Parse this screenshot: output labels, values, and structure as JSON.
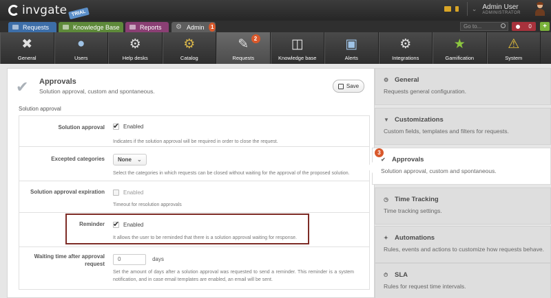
{
  "brand": {
    "name": "invgate",
    "edition": "TRIAL"
  },
  "user": {
    "name": "Admin User",
    "role": "ADMINISTRATOR"
  },
  "tabs": [
    {
      "label": "Requests",
      "color": "#3d6ea8"
    },
    {
      "label": "Knowledge Base",
      "color": "#5e8a3a"
    },
    {
      "label": "Reports",
      "color": "#8b3f74"
    },
    {
      "label": "Admin",
      "color": "#5e5e5e",
      "badge": "1"
    }
  ],
  "search": {
    "placeholder": "Go to..."
  },
  "alerts": {
    "count": "0"
  },
  "toolbar": [
    {
      "label": "General",
      "icon": "tools-icon"
    },
    {
      "label": "Users",
      "icon": "users-icon"
    },
    {
      "label": "Help desks",
      "icon": "helpdesk-icon"
    },
    {
      "label": "Catalog",
      "icon": "catalog-icon"
    },
    {
      "label": "Requests",
      "icon": "requests-icon",
      "active": true,
      "badge": "2"
    },
    {
      "label": "Knowledge base",
      "icon": "database-icon"
    },
    {
      "label": "Alerts",
      "icon": "alerts-icon"
    },
    {
      "label": "Integrations",
      "icon": "integrations-icon"
    },
    {
      "label": "Gamification",
      "icon": "gamification-icon"
    },
    {
      "label": "System",
      "icon": "system-icon"
    }
  ],
  "page": {
    "title": "Approvals",
    "subtitle": "Solution approval, custom and spontaneous.",
    "save_label": "Save",
    "section_title": "Solution approval"
  },
  "fields": {
    "solution_approval": {
      "label": "Solution approval",
      "value": "Enabled",
      "hint": "Indicates if the solution approval will be required in order to close the request."
    },
    "excepted_categories": {
      "label": "Excepted categories",
      "value": "None",
      "hint": "Select the categories in which requests can be closed without waiting for the approval of the proposed solution."
    },
    "expiration": {
      "label": "Solution approval expiration",
      "value": "Enabled",
      "hint": "Timeout for resolution approvals"
    },
    "reminder": {
      "label": "Reminder",
      "value": "Enabled",
      "hint": "It allows the user to be reminded that there is a solution approval waiting for response."
    },
    "waiting_time": {
      "label": "Waiting time after approval request",
      "value": "0",
      "unit": "days",
      "hint": "Set the amount of days after a solution approval was requested to send a reminder. This reminder is a system notification, and in case email templates are enabled, an email will be sent."
    }
  },
  "sidebar": [
    {
      "title": "General",
      "desc": "Requests general configuration.",
      "icon": "gear-icon"
    },
    {
      "title": "Customizations",
      "desc": "Custom fields, templates and filters for requests.",
      "icon": "filter-icon"
    },
    {
      "title": "Approvals",
      "desc": "Solution approval, custom and spontaneous.",
      "icon": "check-icon",
      "active": true,
      "badge": "3"
    },
    {
      "title": "Time Tracking",
      "desc": "Time tracking settings.",
      "icon": "clock-icon"
    },
    {
      "title": "Automations",
      "desc": "Rules, events and actions to customize how requests behave.",
      "icon": "wand-icon"
    },
    {
      "title": "SLA",
      "desc": "Rules for request time intervals.",
      "icon": "sla-icon"
    }
  ]
}
